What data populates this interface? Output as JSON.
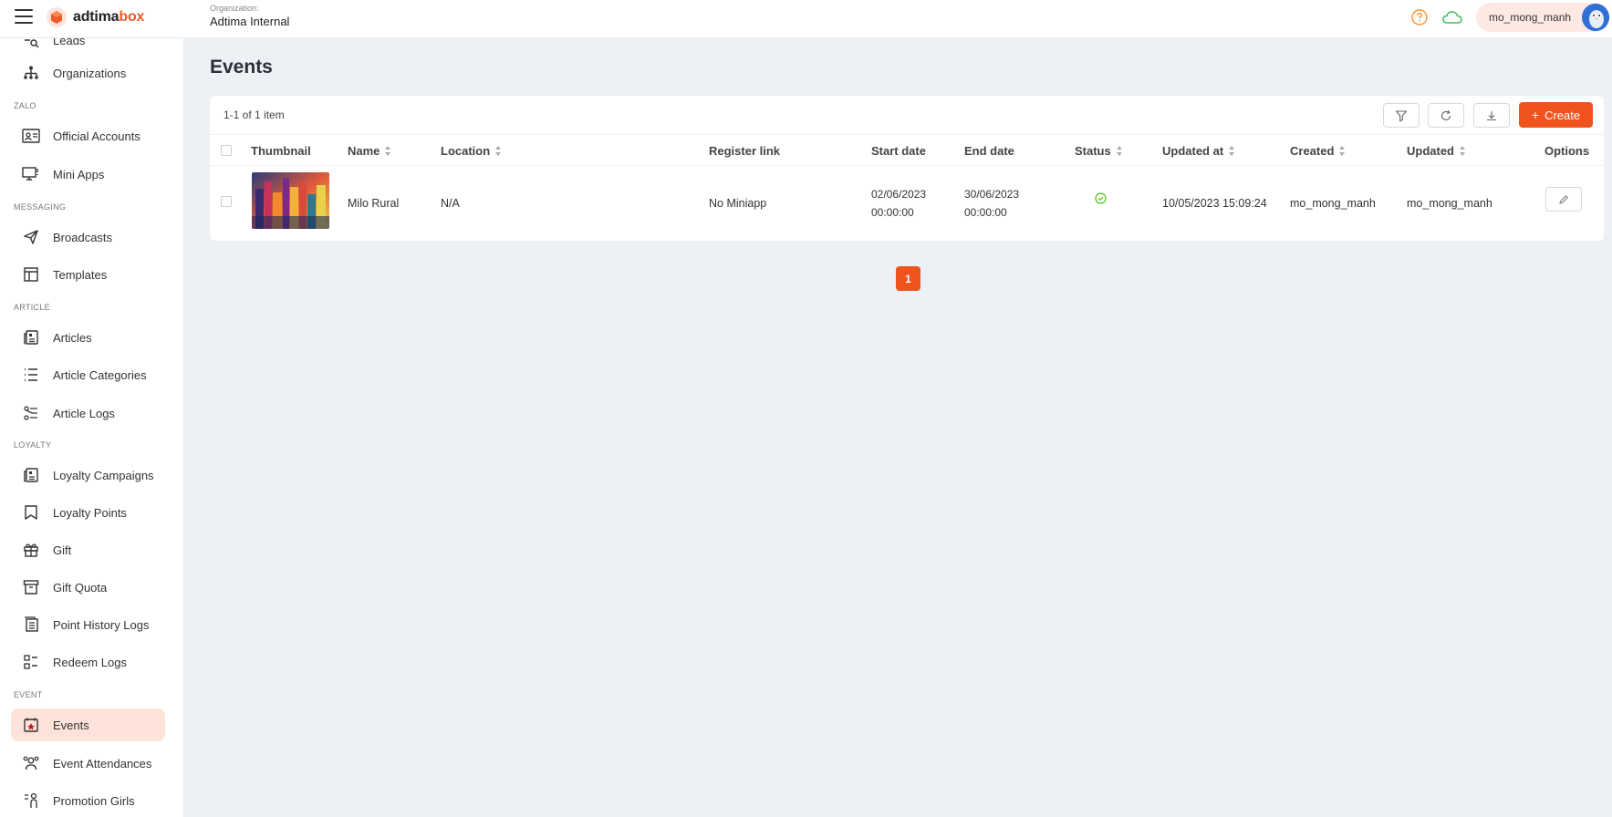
{
  "header": {
    "logo": {
      "part1": "adtima",
      "part2": "box"
    },
    "org_label": "Organization:",
    "org_name": "Adtima Internal",
    "user_name": "mo_mong_manh"
  },
  "sidebar": {
    "partial_item": "Leads",
    "items_top": [
      {
        "label": "Organizations",
        "icon": "org-chart-icon"
      }
    ],
    "sections": {
      "zalo": "ZALO",
      "messaging": "MESSAGING",
      "article": "ARTICLE",
      "loyalty": "LOYALTY",
      "event": "EVENT"
    },
    "zalo_items": [
      {
        "label": "Official Accounts",
        "icon": "id-card-icon"
      },
      {
        "label": "Mini Apps",
        "icon": "desktop-app-icon"
      }
    ],
    "messaging_items": [
      {
        "label": "Broadcasts",
        "icon": "send-icon"
      },
      {
        "label": "Templates",
        "icon": "template-icon"
      }
    ],
    "article_items": [
      {
        "label": "Articles",
        "icon": "article-icon"
      },
      {
        "label": "Article Categories",
        "icon": "list-icon"
      },
      {
        "label": "Article Logs",
        "icon": "logs-icon"
      }
    ],
    "loyalty_items": [
      {
        "label": "Loyalty Campaigns",
        "icon": "campaign-icon"
      },
      {
        "label": "Loyalty Points",
        "icon": "bookmark-icon"
      },
      {
        "label": "Gift",
        "icon": "gift-icon"
      },
      {
        "label": "Gift Quota",
        "icon": "archive-icon"
      },
      {
        "label": "Point History Logs",
        "icon": "history-icon"
      },
      {
        "label": "Redeem Logs",
        "icon": "redeem-icon"
      }
    ],
    "event_items": [
      {
        "label": "Events",
        "icon": "calendar-star-icon",
        "active": true
      },
      {
        "label": "Event Attendances",
        "icon": "people-icon"
      },
      {
        "label": "Promotion Girls",
        "icon": "person-icon"
      }
    ]
  },
  "main": {
    "title": "Events",
    "count_text": "1-1 of 1 item",
    "create_label": "Create",
    "columns": {
      "thumbnail": "Thumbnail",
      "name": "Name",
      "location": "Location",
      "register_link": "Register link",
      "start_date": "Start date",
      "end_date": "End date",
      "status": "Status",
      "updated_at": "Updated at",
      "created": "Created",
      "updated": "Updated",
      "options": "Options"
    },
    "rows": [
      {
        "name": "Milo Rural",
        "location": "N/A",
        "register_link": "No Miniapp",
        "start_date": "02/06/2023",
        "start_time": "00:00:00",
        "end_date": "30/06/2023",
        "end_time": "00:00:00",
        "status": "active",
        "updated_at": "10/05/2023 15:09:24",
        "created": "mo_mong_manh",
        "updated": "mo_mong_manh"
      }
    ],
    "pagination": {
      "current": "1"
    }
  },
  "colors": {
    "accent": "#f0541e",
    "active_bg": "#fde3da",
    "status_ok": "#52c41a"
  }
}
